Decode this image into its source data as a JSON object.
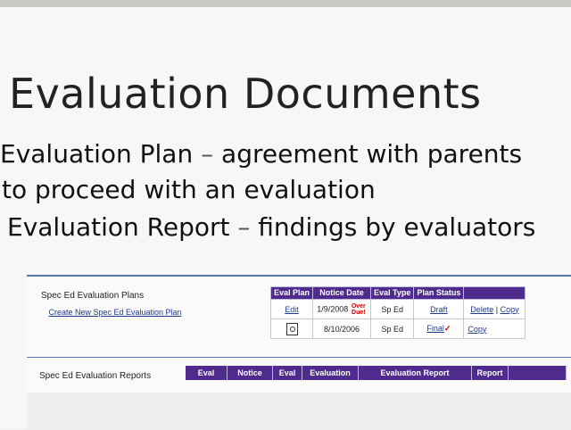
{
  "slide": {
    "title": "Evaluation Documents",
    "bullets": [
      {
        "term": "Evaluation Plan",
        "dash": "–",
        "rest": "agreement with parents"
      },
      {
        "line": "to proceed with an evaluation"
      },
      {
        "term": "Evaluation Report",
        "dash": "–",
        "rest": "findings by evaluators"
      }
    ]
  },
  "plans": {
    "label": "Spec Ed Evaluation Plans",
    "create_link": "Create New Spec Ed Evaluation Plan",
    "headers": [
      "Eval Plan",
      "Notice Date",
      "Eval Type",
      "Plan Status",
      ""
    ],
    "rows": [
      {
        "action": "Edit",
        "date": "1/9/2008",
        "overdue": "Over Due!",
        "type": "Sp Ed",
        "status": "Draft",
        "links": [
          "Delete",
          "Copy"
        ],
        "sep": "|"
      },
      {
        "action_icon": "document-view-icon",
        "date": "8/10/2006",
        "type": "Sp Ed",
        "status": "Final",
        "check": "✓",
        "links": [
          "Copy"
        ]
      }
    ]
  },
  "reports": {
    "label": "Spec Ed Evaluation Reports",
    "headers": [
      "Eval",
      "Notice",
      "Eval",
      "Evaluation",
      "Evaluation Report",
      "Report"
    ]
  },
  "colors": {
    "header_bg": "#4e2b8c",
    "link": "#1f3a93",
    "accent_line": "#5b76a8",
    "alert": "#cc0000"
  }
}
